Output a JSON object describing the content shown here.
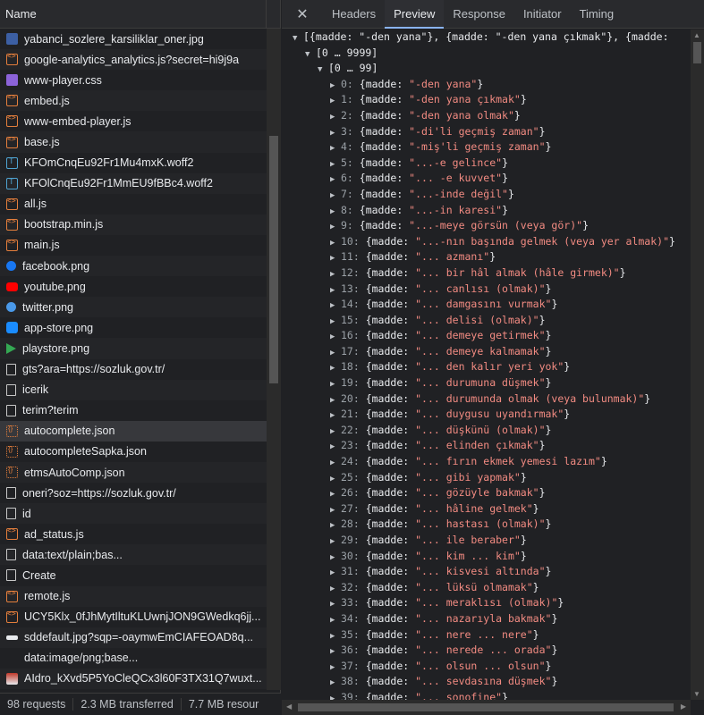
{
  "network": {
    "name_header": "Name",
    "files": [
      {
        "name": "yabanci_sozlere_karsiliklar_oner.jpg",
        "icon": "image-icon"
      },
      {
        "name": "google-analytics_analytics.js?secret=hi9j9a",
        "icon": "script-icon"
      },
      {
        "name": "www-player.css",
        "icon": "stylesheet-icon"
      },
      {
        "name": "embed.js",
        "icon": "script-icon"
      },
      {
        "name": "www-embed-player.js",
        "icon": "script-icon"
      },
      {
        "name": "base.js",
        "icon": "script-icon"
      },
      {
        "name": "KFOmCnqEu92Fr1Mu4mxK.woff2",
        "icon": "font-icon"
      },
      {
        "name": "KFOlCnqEu92Fr1MmEU9fBBc4.woff2",
        "icon": "font-icon"
      },
      {
        "name": "all.js",
        "icon": "script-icon"
      },
      {
        "name": "bootstrap.min.js",
        "icon": "script-icon"
      },
      {
        "name": "main.js",
        "icon": "script-icon"
      },
      {
        "name": "facebook.png",
        "icon": "facebook-icon"
      },
      {
        "name": "youtube.png",
        "icon": "youtube-icon"
      },
      {
        "name": "twitter.png",
        "icon": "twitter-icon"
      },
      {
        "name": "app-store.png",
        "icon": "app-store-icon"
      },
      {
        "name": "playstore.png",
        "icon": "playstore-icon"
      },
      {
        "name": "gts?ara=https://sozluk.gov.tr/",
        "icon": "document-icon"
      },
      {
        "name": "icerik",
        "icon": "document-icon"
      },
      {
        "name": "terim?terim",
        "icon": "document-icon"
      },
      {
        "name": "autocomplete.json",
        "icon": "json-icon",
        "selected": true
      },
      {
        "name": "autocompleteSapka.json",
        "icon": "json-icon"
      },
      {
        "name": "etmsAutoComp.json",
        "icon": "json-icon"
      },
      {
        "name": "oneri?soz=https://sozluk.gov.tr/",
        "icon": "document-icon"
      },
      {
        "name": "id",
        "icon": "document-icon"
      },
      {
        "name": "ad_status.js",
        "icon": "script-icon"
      },
      {
        "name": "data:text/plain;bas...",
        "icon": "document-icon"
      },
      {
        "name": "Create",
        "icon": "document-icon"
      },
      {
        "name": "remote.js",
        "icon": "script-icon"
      },
      {
        "name": "UCY5Klx_0fJhMytIltuKLUwnjJON9GWedkq6jj...",
        "icon": "script-icon"
      },
      {
        "name": "sddefault.jpg?sqp=-oaymwEmCIAFEOAD8q...",
        "icon": "dark-image-icon"
      },
      {
        "name": "data:image/png;base...",
        "icon": "blank-icon"
      },
      {
        "name": "AIdro_kXvd5P5YoCleQCx3l60F3TX31Q7wuxt...",
        "icon": "thumbnail-icon"
      }
    ],
    "status": {
      "requests": "98 requests",
      "transferred": "2.3 MB transferred",
      "resources": "7.7 MB resour"
    }
  },
  "tabs": {
    "close": "✕",
    "headers": "Headers",
    "preview": "Preview",
    "response": "Response",
    "initiator": "Initiator",
    "timing": "Timing"
  },
  "preview": {
    "root_line": "[{madde: \"-den yana\"}, {madde: \"-den yana çıkmak\"}, {madde:",
    "range_outer": "[0 … 9999]",
    "range_inner": "[0 … 99]",
    "items": [
      "-den yana",
      "-den yana çıkmak",
      "-den yana olmak",
      "-di'li geçmiş zaman",
      "-miş'li geçmiş zaman",
      "...-e gelince",
      "... -e kuvvet",
      "...-inde değil",
      "...-in karesi",
      "...-meye görsün (veya gör)",
      "...-nın başında gelmek (veya yer almak)",
      "... azmanı",
      "... bir hâl almak (hâle girmek)",
      "... canlısı (olmak)",
      "... damgasını vurmak",
      "... delisi (olmak)",
      "... demeye getirmek",
      "... demeye kalmamak",
      "... den kalır yeri yok",
      "... durumuna düşmek",
      "... durumunda olmak (veya bulunmak)",
      "... duygusu uyandırmak",
      "... düşkünü (olmak)",
      "... elinden çıkmak",
      "... fırın ekmek yemesi lazım",
      "... gibi yapmak",
      "... gözüyle bakmak",
      "... hâline gelmek",
      "... hastası (olmak)",
      "... ile beraber",
      "... kim ... kim",
      "... kisvesi altında",
      "... lüksü olmamak",
      "... meraklısı (olmak)",
      "... nazarıyla bakmak",
      "... nere ... nere",
      "... nerede ... orada",
      "... olsun ... olsun",
      "... sevdasına düşmek",
      "... sonofine"
    ]
  }
}
